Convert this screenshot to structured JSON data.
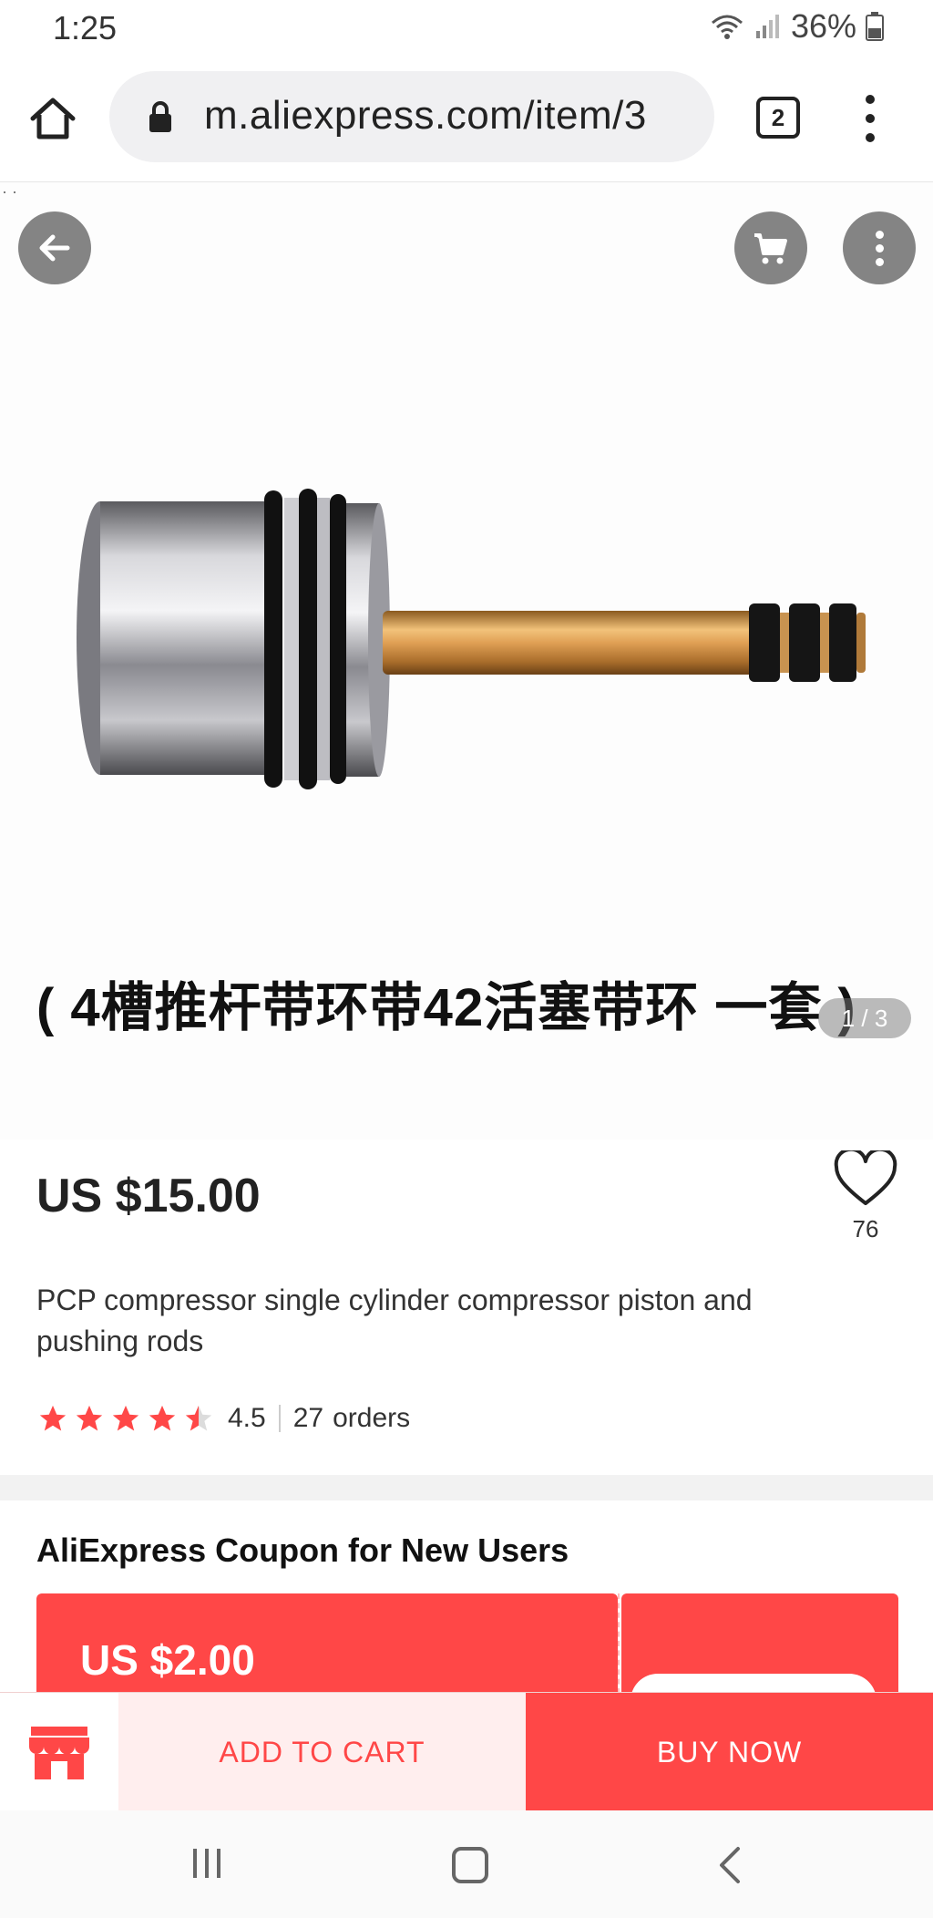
{
  "status_bar": {
    "time": "1:25",
    "battery": "36%"
  },
  "browser": {
    "url": "m.aliexpress.com/item/3",
    "tab_count": "2"
  },
  "gallery": {
    "caption": "( 4槽推杆带环带42活塞带环 一套 )",
    "page_indicator": "1 / 3"
  },
  "product": {
    "price": "US $15.00",
    "wishlist_count": "76",
    "title": "PCP compressor single cylinder compressor piston and pushing rods",
    "rating": "4.5",
    "orders_count": "27",
    "orders_label": "orders"
  },
  "coupon": {
    "heading": "AliExpress Coupon for New Users",
    "amount": "US $2.00"
  },
  "actions": {
    "add_to_cart": "ADD TO CART",
    "buy_now": "BUY NOW"
  },
  "colors": {
    "accent": "#ff4747",
    "star": "#ff4747",
    "text": "#222222"
  },
  "icons": [
    "home-icon",
    "lock-icon",
    "back-arrow-icon",
    "cart-icon",
    "more-vert-icon",
    "heart-icon",
    "star-icon",
    "store-icon"
  ]
}
